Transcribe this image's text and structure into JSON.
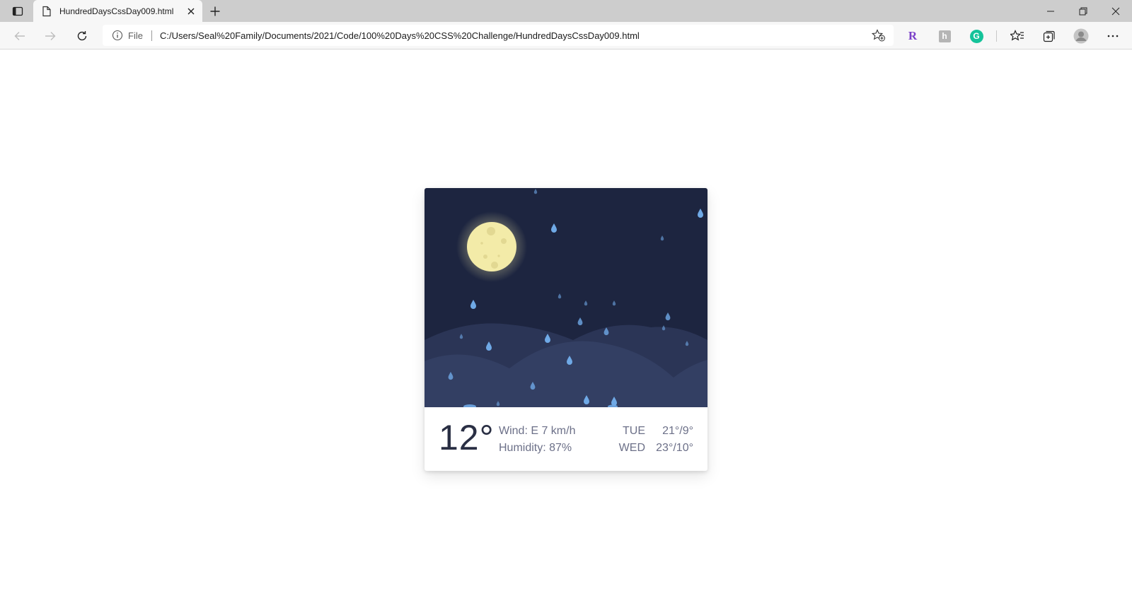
{
  "browser": {
    "tab_title": "HundredDaysCssDay009.html",
    "scheme_label": "File",
    "url": "C:/Users/Seal%20Family/Documents/2021/Code/100%20Days%20CSS%20Challenge/HundredDaysCssDay009.html",
    "extensions": [
      {
        "name": "r-extension-icon",
        "glyph": "R",
        "color": "#7a3fc8"
      },
      {
        "name": "translate-extension-icon",
        "glyph": "h",
        "color": "#9a9a9a"
      },
      {
        "name": "grammarly-icon",
        "glyph": "G",
        "color": "#15c39a"
      }
    ]
  },
  "weather": {
    "temperature": "12°",
    "wind": "Wind: E 7 km/h",
    "humidity": "Humidity: 87%",
    "forecast": [
      {
        "day": "TUE",
        "temps": "21°/9°"
      },
      {
        "day": "WED",
        "temps": "23°/10°"
      }
    ],
    "colors": {
      "sky": "#1d2540",
      "hills_back": "#2b3556",
      "hills_front": "#333f63",
      "moon": "#f3eba8",
      "rain": "#6fa9e6"
    }
  }
}
